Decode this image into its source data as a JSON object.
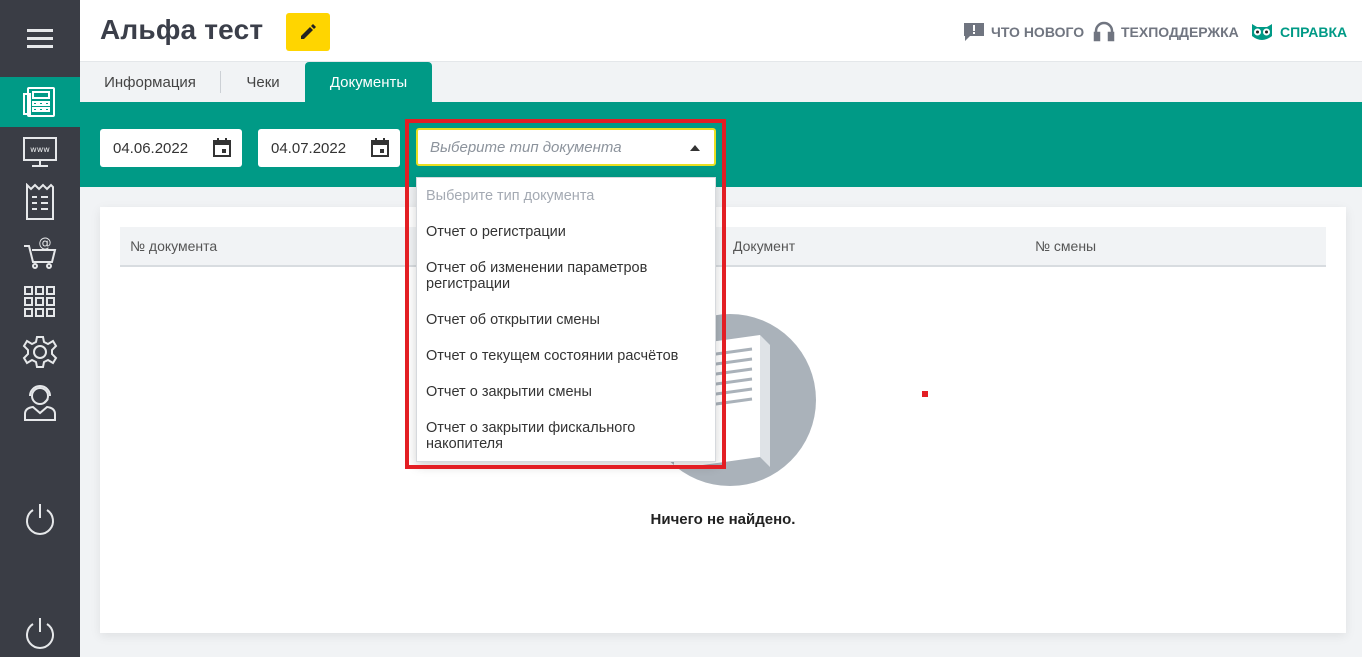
{
  "header": {
    "title": "Альфа тест",
    "links": {
      "whats_new": "ЧТО НОВОГО",
      "support": "ТЕХПОДДЕРЖКА",
      "help": "СПРАВКА"
    }
  },
  "tabs": [
    "Информация",
    "Чеки",
    "Документы"
  ],
  "active_tab": "Документы",
  "filters": {
    "date_from": "04.06.2022",
    "date_to": "04.07.2022",
    "doc_type_placeholder": "Выберите тип документа"
  },
  "dropdown": {
    "placeholder": "Выберите тип документа",
    "options": [
      "Отчет о регистрации",
      "Отчет об изменении параметров регистрации",
      "Отчет об открытии смены",
      "Отчет о текущем состоянии расчётов",
      "Отчет о закрытии смены",
      "Отчет о закрытии фискального накопителя"
    ]
  },
  "table": {
    "columns": [
      "№ документа",
      "Документ",
      "№ смены"
    ]
  },
  "empty_state": "Ничего не найдено.",
  "colors": {
    "accent": "#009a86",
    "sidebar": "#3a3d45",
    "edit_button": "#ffd500",
    "highlight": "#e31e24"
  },
  "sidebar_icons": [
    "menu-icon",
    "cash-register-icon",
    "web-monitor-icon",
    "receipt-icon",
    "shopping-cart-icon",
    "apps-grid-icon",
    "gear-icon",
    "support-agent-icon",
    "power-icon",
    "power-icon"
  ]
}
